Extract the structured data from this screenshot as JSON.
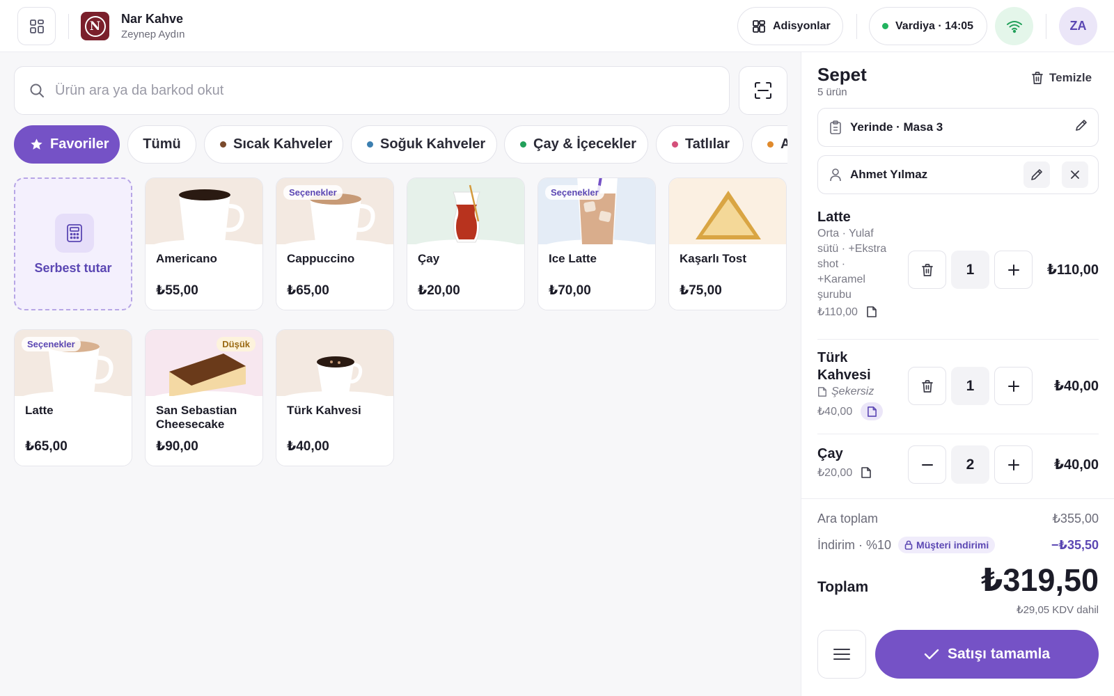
{
  "header": {
    "brand_name": "Nar Kahve",
    "brand_initial": "N",
    "user_name": "Zeynep Aydın",
    "adisyonlar_label": "Adisyonlar",
    "vardiya_label": "Vardiya · 14:05",
    "avatar_initials": "ZA"
  },
  "search": {
    "placeholder": "Ürün ara ya da barkod okut"
  },
  "categories": [
    {
      "label": "Favoriler",
      "active": true,
      "icon": "star-icon"
    },
    {
      "label": "Tümü"
    },
    {
      "label": "Sıcak Kahveler",
      "dot": "#7a4a2c"
    },
    {
      "label": "Soğuk Kahveler",
      "dot": "#3c7fb0"
    },
    {
      "label": "Çay & İçecekler",
      "dot": "#22a05a"
    },
    {
      "label": "Tatlılar",
      "dot": "#d4507a"
    },
    {
      "label": "Atıştırmalık",
      "dot": "#e08a2c"
    }
  ],
  "custom_amount": {
    "label": "Serbest tutar",
    "icon": "calculator-icon"
  },
  "products": [
    {
      "name": "Americano",
      "price": "₺55,00"
    },
    {
      "name": "Cappuccino",
      "price": "₺65,00",
      "badge": "Seçenekler"
    },
    {
      "name": "Çay",
      "price": "₺20,00"
    },
    {
      "name": "Ice Latte",
      "price": "₺70,00",
      "badge": "Seçenekler"
    },
    {
      "name": "Kaşarlı Tost",
      "price": "₺75,00"
    },
    {
      "name": "Latte",
      "price": "₺65,00",
      "badge": "Seçenekler"
    },
    {
      "name": "San Sebastian Cheesecake",
      "price": "₺90,00",
      "badge": "Düşük"
    },
    {
      "name": "Türk Kahvesi",
      "price": "₺40,00"
    }
  ],
  "cart": {
    "title": "Sepet",
    "count": "5 ürün",
    "clear_label": "Temizle",
    "order_type": "Yerinde · Masa 3",
    "customer": "Ahmet Yılmaz",
    "items": [
      {
        "name": "Latte",
        "options": "Orta · Yulaf sütü · +Ekstra shot · +Karamel şurubu",
        "unit": "₺110,00",
        "qty": "1",
        "total": "₺110,00"
      },
      {
        "name": "Türk Kahvesi",
        "note": "Şekersiz",
        "unit": "₺40,00",
        "qty": "1",
        "total": "₺40,00"
      },
      {
        "name": "Çay",
        "unit": "₺20,00",
        "qty": "2",
        "total": "₺40,00"
      }
    ],
    "subtotal_label": "Ara toplam",
    "subtotal": "₺355,00",
    "discount_label": "İndirim · %10",
    "discount_badge": "Müşteri indirimi",
    "discount": "−₺35,50",
    "total_label": "Toplam",
    "total": "₺319,50",
    "kdv": "₺29,05 KDV dahil",
    "pay_label": "Satışı tamamla"
  }
}
